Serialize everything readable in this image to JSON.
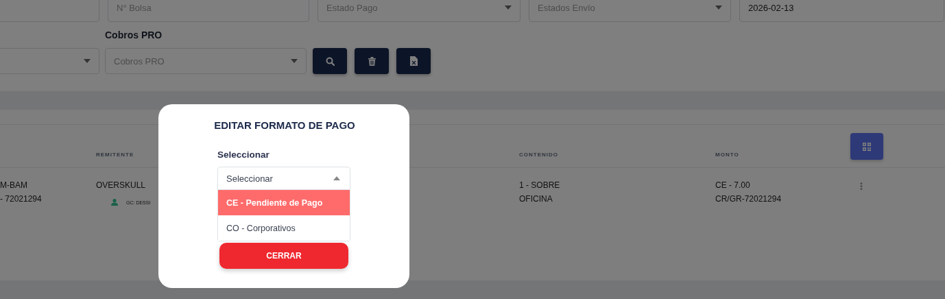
{
  "filters": {
    "top_row": [
      {
        "kind": "input"
      },
      {
        "kind": "input",
        "placeholder": "N° Bolsa"
      },
      {
        "kind": "select",
        "placeholder": "Estado Pago"
      },
      {
        "kind": "select",
        "placeholder": "Estados Envío"
      },
      {
        "kind": "input",
        "value": "2026-02-13"
      }
    ],
    "second_row": [
      {
        "kind": "select"
      },
      {
        "kind": "select",
        "label": "Cobros PRO",
        "placeholder": "Cobros PRO"
      }
    ],
    "buttons": [
      {
        "kind": "search"
      },
      {
        "kind": "delete"
      },
      {
        "kind": "excel"
      }
    ]
  },
  "table": {
    "columns": [
      {},
      {
        "label": "REMITENTE"
      },
      {},
      {
        "label": "CONTENIDO"
      },
      {
        "label": "MONTO"
      }
    ],
    "rows": [
      {
        "cells": [
          {
            "lines": [
              "M-BAM",
              "- 72021294"
            ]
          },
          {
            "lines": [
              "OVERSKULL"
            ],
            "contact": "GC: DESSI"
          },
          {},
          {
            "lines": [
              "1 - SOBRE",
              "OFICINA"
            ]
          },
          {
            "lines": [
              "CE - 7.00",
              "CR/GR-72021294"
            ]
          }
        ]
      }
    ]
  },
  "modal": {
    "title": "EDITAR FORMATO DE PAGO",
    "label": "Seleccionar",
    "select": {
      "placeholder": "Seleccionar",
      "expanded": true,
      "options": [
        {
          "label": "CE - Pendiente de Pago",
          "selected": true
        },
        {
          "label": "CO - Corporativos",
          "selected": false
        }
      ]
    },
    "button": "CERRAR"
  }
}
